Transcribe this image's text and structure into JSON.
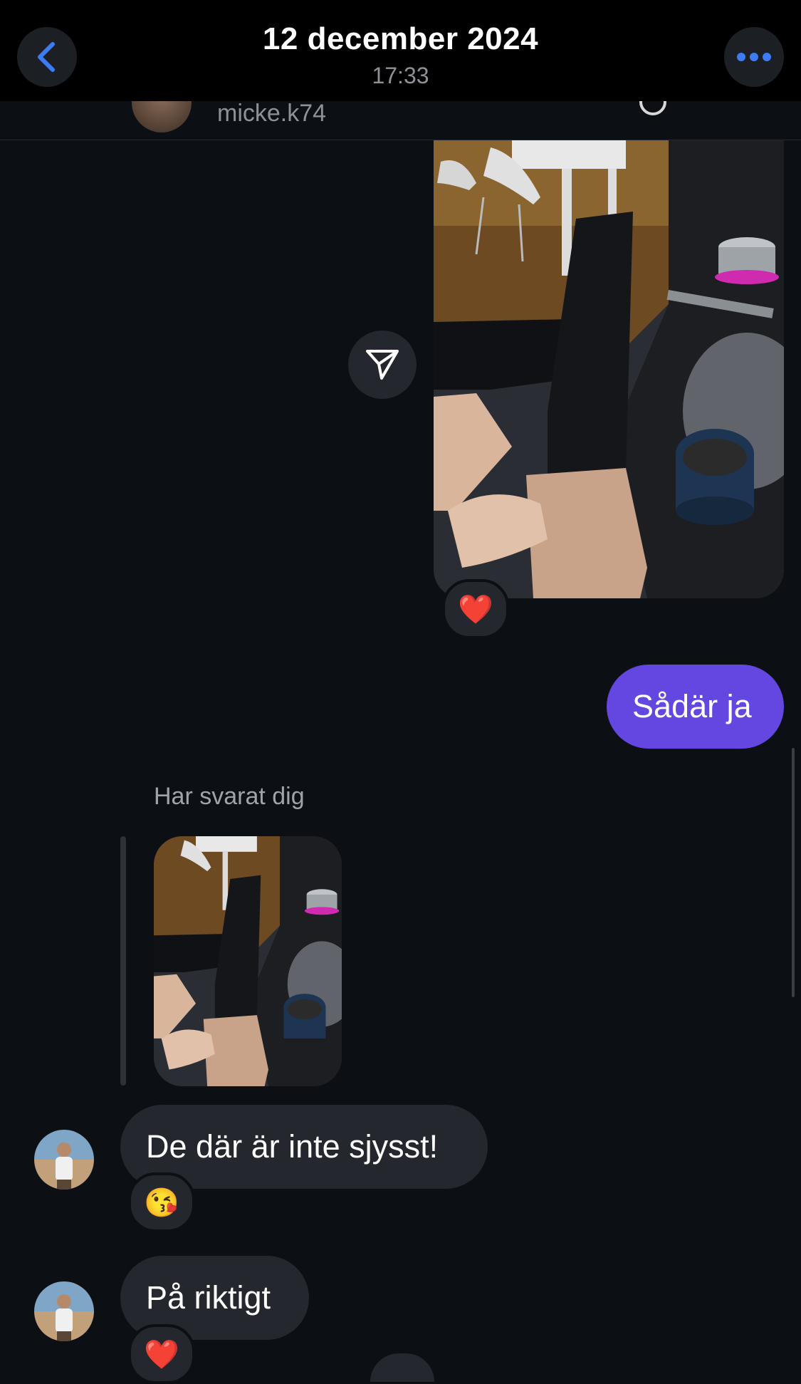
{
  "header": {
    "date": "12 december 2024",
    "time": "17:33",
    "back_icon": "chevron-left-icon",
    "more_icon": "ellipsis-icon"
  },
  "peek": {
    "username": "micke.k74"
  },
  "messages": {
    "photo_sent": {
      "reaction": "❤️",
      "forward_icon": "paper-plane-icon"
    },
    "sent_text": "Sådär ja",
    "reply_label": "Har svarat dig",
    "received_1": {
      "text": "De där är inte sjysst!",
      "reaction": "😘"
    },
    "received_2": {
      "text": "På riktigt",
      "reaction": "❤️"
    }
  },
  "colors": {
    "accent": "#6446e0",
    "icon_blue": "#3d7cf5",
    "bubble_in": "#24272d",
    "background": "#0c0f14"
  }
}
